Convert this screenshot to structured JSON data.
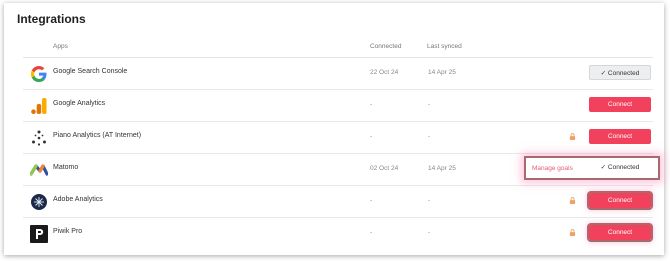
{
  "title": "Integrations",
  "columns": {
    "apps": "Apps",
    "connected": "Connected",
    "last_synced": "Last synced"
  },
  "rows": [
    {
      "name": "Google Search Console",
      "connected": "22 Oct 24",
      "synced": "14 Apr 25",
      "action": "✓ Connected",
      "icon": "google-icon"
    },
    {
      "name": "Google Analytics",
      "connected": "-",
      "synced": "-",
      "action": "Connect",
      "icon": "google-analytics-icon"
    },
    {
      "name": "Piano Analytics (AT Internet)",
      "connected": "-",
      "synced": "-",
      "action": "Connect",
      "icon": "piano-analytics-icon"
    },
    {
      "name": "Matomo",
      "connected": "02 Oct 24",
      "synced": "14 Apr 25",
      "action": "✓ Connected",
      "manage": "Manage goals",
      "icon": "matomo-icon"
    },
    {
      "name": "Adobe Analytics",
      "connected": "-",
      "synced": "-",
      "action": "Connect",
      "icon": "adobe-analytics-icon"
    },
    {
      "name": "Piwik Pro",
      "connected": "-",
      "synced": "-",
      "action": "Connect",
      "icon": "piwik-pro-icon"
    }
  ],
  "colors": {
    "accent": "#f2415d",
    "highlight_border": "#a86b6b"
  }
}
